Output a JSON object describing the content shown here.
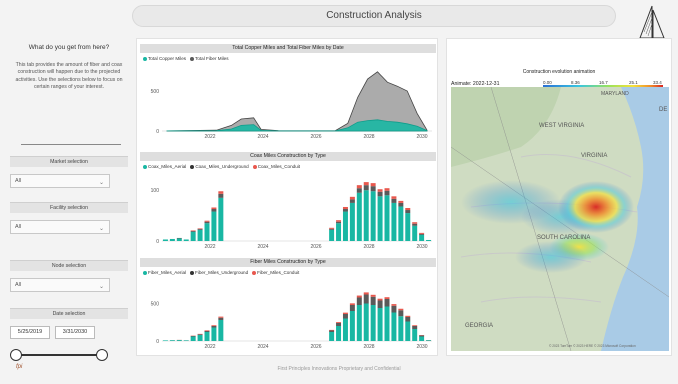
{
  "header": {
    "title": "Construction Analysis"
  },
  "intro": {
    "title": "What do you get from here?",
    "text": "This tab provides the amount of fiber and coax construction will happen due to the projected activities. Use the selections below to focus on certain ranges of your interest."
  },
  "filters": {
    "market": {
      "label": "Market selection",
      "value": "All"
    },
    "facility": {
      "label": "Facility selection",
      "value": "All"
    },
    "node": {
      "label": "Node selection",
      "value": "All"
    },
    "date": {
      "label": "Date selection",
      "start": "5/25/2019",
      "end": "3/31/2030"
    }
  },
  "charts": {
    "total": {
      "title": "Total Copper Miles and Total Fiber Miles by Date",
      "legend": [
        "Total Copper Miles",
        "Total Fiber Miles"
      ]
    },
    "coax": {
      "title": "Coax Miles Construction by Type",
      "legend": [
        "Coax_Miles_Aerial",
        "Coax_Miles_Underground",
        "Coax_Miles_Conduit"
      ]
    },
    "fiber": {
      "title": "Fiber Miles Construction by Type",
      "legend": [
        "Fiber_Miles_Aerial",
        "Fiber_Miles_Underground",
        "Fiber_Miles_Conduit"
      ]
    }
  },
  "map": {
    "title": "Construction evolution animation",
    "animate_label": "Animate: 2022-12-31",
    "scale_labels": [
      "0.00",
      "8.36",
      "16.7",
      "25.1",
      "33.4"
    ],
    "states": [
      "WEST VIRGINIA",
      "VIRGINIA",
      "SOUTH CAROLINA",
      "GEORGIA",
      "DE",
      "MARYLAND"
    ],
    "attribution": "© 2023 TomTom © 2023 HERE © 2023 Microsoft Corporation"
  },
  "footer": {
    "text": "First Principles Innovations Proprietary and Confidential",
    "logo": "fpi"
  },
  "colors": {
    "teal": "#19b7a3",
    "grey": "#5a5a5a",
    "red": "#e8584e"
  },
  "chart_data": [
    {
      "type": "area",
      "title": "Total Copper Miles and Total Fiber Miles by Date",
      "x_ticks": [
        "2022",
        "2024",
        "2026",
        "2028",
        "2030"
      ],
      "y_ticks": [
        0,
        500
      ],
      "ylim": [
        0,
        800
      ],
      "series": [
        {
          "name": "Total Copper Miles",
          "x": [
            2019.5,
            2020.5,
            2021.5,
            2022.1,
            2022.5,
            2023.0,
            2023.3,
            2024,
            2025,
            2026.3,
            2026.8,
            2027.2,
            2027.6,
            2028.0,
            2028.4,
            2028.8,
            2029.2,
            2029.6,
            2030.0
          ],
          "values": [
            2,
            6,
            10,
            70,
            150,
            165,
            20,
            5,
            3,
            5,
            95,
            420,
            650,
            740,
            610,
            560,
            500,
            220,
            10
          ]
        },
        {
          "name": "Total Fiber Miles",
          "x": [
            2019.5,
            2020.5,
            2021.5,
            2022.1,
            2022.5,
            2023.0,
            2023.3,
            2024,
            2025,
            2026.3,
            2026.8,
            2027.2,
            2027.6,
            2028.0,
            2028.4,
            2028.8,
            2029.2,
            2029.6,
            2030.0
          ],
          "values": [
            1,
            3,
            5,
            25,
            70,
            80,
            8,
            2,
            1,
            2,
            40,
            110,
            130,
            140,
            120,
            110,
            90,
            60,
            5
          ]
        }
      ]
    },
    {
      "type": "bar",
      "title": "Coax Miles Construction by Type",
      "x_ticks": [
        "2022",
        "2024",
        "2026",
        "2028",
        "2030"
      ],
      "y_ticks": [
        0,
        100
      ],
      "ylim": [
        0,
        130
      ],
      "series": [
        {
          "name": "Coax_Miles_Aerial",
          "values": [
            3,
            4,
            5,
            3,
            18,
            22,
            35,
            58,
            85,
            0,
            0,
            0,
            0,
            0,
            0,
            0,
            0,
            0,
            0,
            0,
            0,
            0,
            0,
            0,
            22,
            35,
            58,
            75,
            95,
            100,
            98,
            88,
            90,
            75,
            68,
            55,
            30,
            12,
            2
          ]
        },
        {
          "name": "Coax_Miles_Underground",
          "values": [
            0,
            0,
            1,
            0,
            2,
            2,
            3,
            5,
            8,
            0,
            0,
            0,
            0,
            0,
            0,
            0,
            0,
            0,
            0,
            0,
            0,
            0,
            0,
            0,
            2,
            3,
            5,
            7,
            9,
            10,
            10,
            9,
            9,
            8,
            7,
            6,
            4,
            2,
            0
          ]
        },
        {
          "name": "Coax_Miles_Conduit",
          "values": [
            0,
            0,
            0,
            0,
            1,
            1,
            2,
            3,
            5,
            0,
            0,
            0,
            0,
            0,
            0,
            0,
            0,
            0,
            0,
            0,
            0,
            0,
            0,
            0,
            2,
            3,
            4,
            5,
            6,
            6,
            6,
            5,
            5,
            5,
            4,
            4,
            3,
            2,
            0
          ]
        }
      ]
    },
    {
      "type": "bar",
      "title": "Fiber Miles Construction by Type",
      "x_ticks": [
        "2022",
        "2024",
        "2026",
        "2028",
        "2030"
      ],
      "y_ticks": [
        0,
        500
      ],
      "ylim": [
        0,
        800
      ],
      "series": [
        {
          "name": "Fiber_Miles_Aerial",
          "values": [
            8,
            10,
            12,
            8,
            60,
            80,
            120,
            180,
            280,
            0,
            0,
            0,
            0,
            0,
            0,
            0,
            0,
            0,
            0,
            0,
            0,
            0,
            0,
            0,
            120,
            200,
            300,
            400,
            480,
            500,
            480,
            440,
            460,
            380,
            330,
            260,
            160,
            60,
            10
          ]
        },
        {
          "name": "Fiber_Miles_Underground",
          "values": [
            0,
            1,
            2,
            1,
            8,
            10,
            15,
            20,
            30,
            0,
            0,
            0,
            0,
            0,
            0,
            0,
            0,
            0,
            0,
            0,
            0,
            0,
            0,
            0,
            20,
            40,
            60,
            80,
            100,
            120,
            110,
            100,
            100,
            90,
            80,
            60,
            40,
            15,
            2
          ]
        },
        {
          "name": "Fiber_Miles_Conduit",
          "values": [
            0,
            0,
            1,
            0,
            4,
            5,
            8,
            10,
            15,
            0,
            0,
            0,
            0,
            0,
            0,
            0,
            0,
            0,
            0,
            0,
            0,
            0,
            0,
            0,
            8,
            12,
            18,
            22,
            26,
            28,
            26,
            24,
            24,
            22,
            20,
            16,
            10,
            5,
            1
          ]
        }
      ]
    }
  ]
}
